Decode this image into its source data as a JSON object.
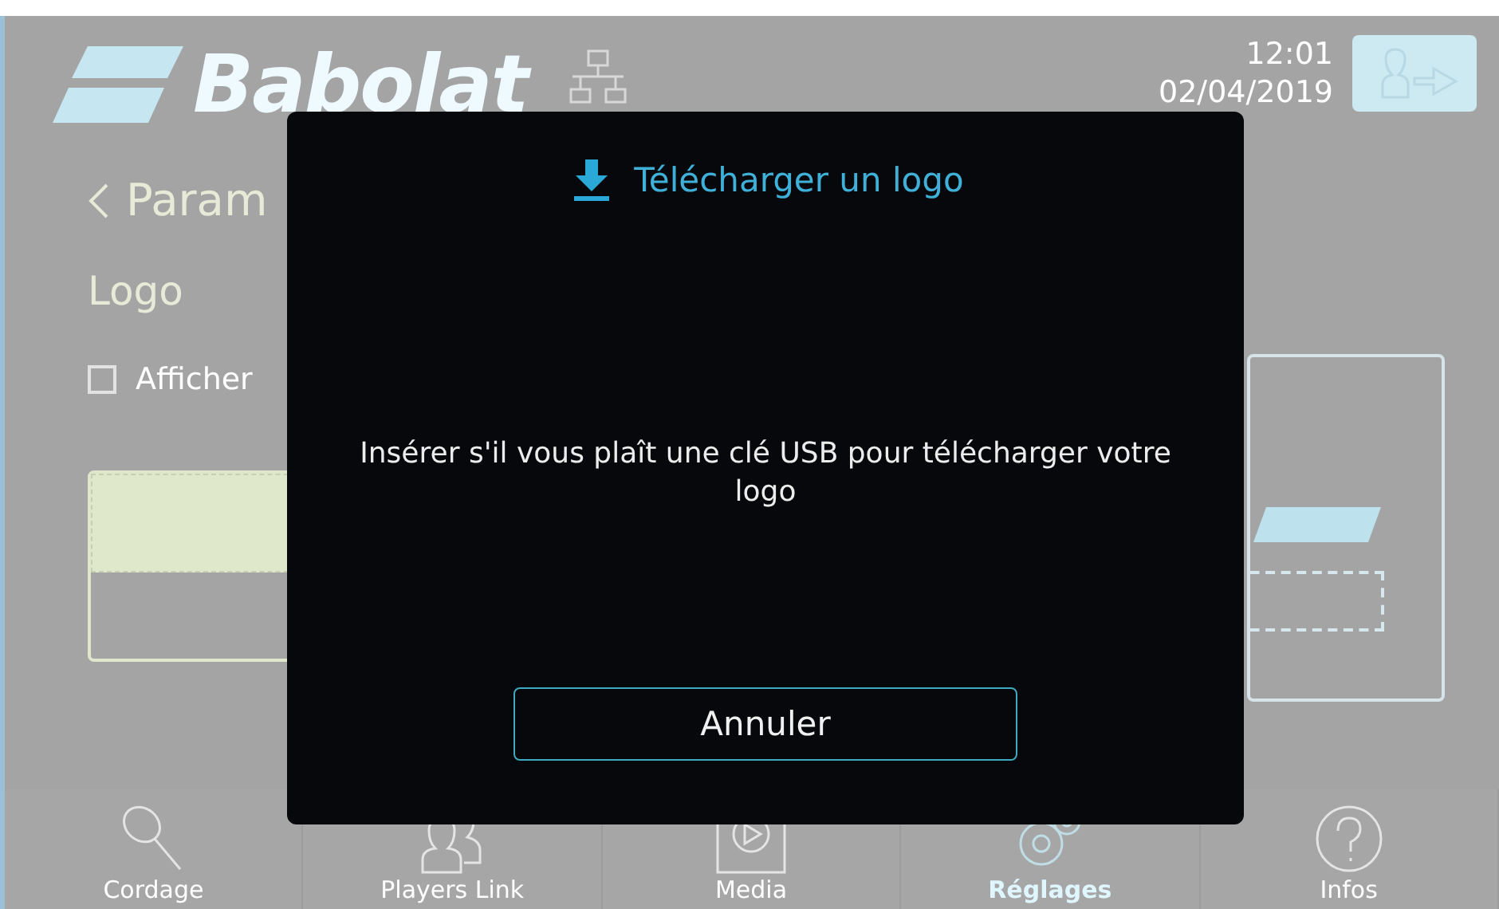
{
  "header": {
    "logo": "Babolat",
    "time": "12:01",
    "date": "02/04/2019"
  },
  "page": {
    "back_label": "Param",
    "section_title": "Logo",
    "checkbox": {
      "label": "Afficher",
      "checked": false
    }
  },
  "nav": [
    {
      "label": "Cordage",
      "selected": false
    },
    {
      "label": "Players Link",
      "selected": false
    },
    {
      "label": "Media",
      "selected": false
    },
    {
      "label": "Réglages",
      "selected": true
    },
    {
      "label": "Infos",
      "selected": false
    }
  ],
  "dialog": {
    "title": "Télécharger un logo",
    "message": "Insérer s'il vous plaît une clé USB pour télécharger votre logo",
    "button": "Annuler"
  }
}
